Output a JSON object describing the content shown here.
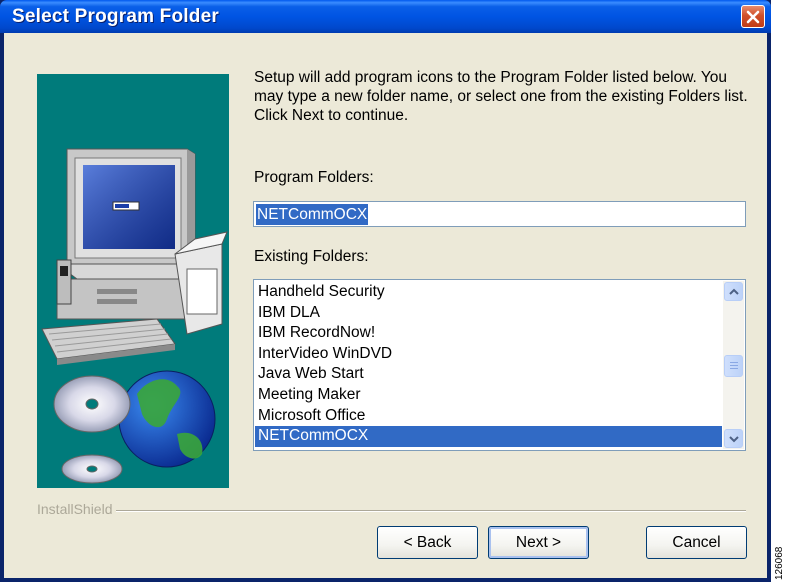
{
  "window": {
    "title": "Select Program Folder"
  },
  "content": {
    "description": "Setup will add program icons to the Program Folder listed below. You may type a new folder name, or select one from the existing Folders list.  Click Next to continue.",
    "program_folders_label": "Program Folders:",
    "program_folder_value": "NETCommOCX",
    "existing_folders_label": "Existing Folders:",
    "existing_folders": [
      "Handheld Security",
      "IBM DLA",
      "IBM RecordNow!",
      "InterVideo WinDVD",
      "Java Web Start",
      "Meeting Maker",
      "Microsoft Office",
      "NETCommOCX"
    ],
    "selected_folder": "NETCommOCX"
  },
  "footer": {
    "brand": "InstallShield",
    "back_label": "< Back",
    "next_label": "Next >",
    "cancel_label": "Cancel"
  },
  "figure_number": "126068",
  "icons": {
    "close": "close-x-icon",
    "scroll_up": "chevron-up-icon",
    "scroll_down": "chevron-down-icon"
  },
  "colors": {
    "titlebar": "#0054e3",
    "selection": "#316ac5",
    "side_panel": "#007b7b",
    "close_button": "#d0502a"
  }
}
